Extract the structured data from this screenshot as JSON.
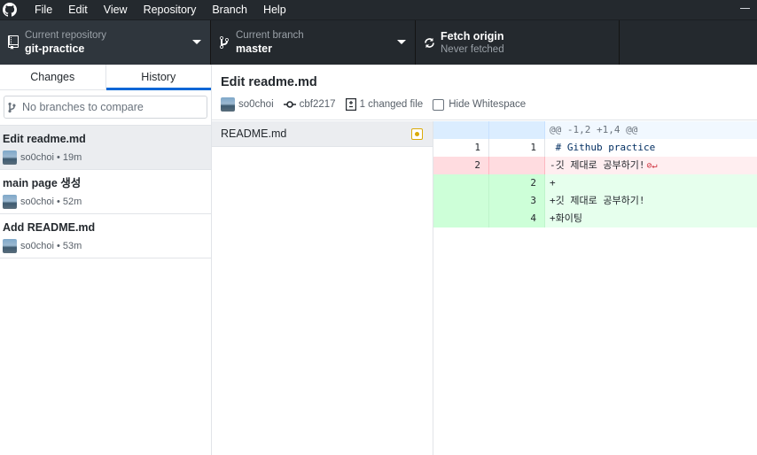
{
  "menu": [
    "File",
    "Edit",
    "View",
    "Repository",
    "Branch",
    "Help"
  ],
  "toolbar": {
    "repo": {
      "label": "Current repository",
      "value": "git-practice"
    },
    "branch": {
      "label": "Current branch",
      "value": "master"
    },
    "fetch": {
      "label": "Fetch origin",
      "sub": "Never fetched"
    }
  },
  "sidebar": {
    "tabs": {
      "changes": "Changes",
      "history": "History"
    },
    "compare_placeholder": "No branches to compare",
    "commits": [
      {
        "title": "Edit readme.md",
        "meta": "so0choi • 19m"
      },
      {
        "title": "main page 생성",
        "meta": "so0choi • 52m"
      },
      {
        "title": "Add README.md",
        "meta": "so0choi • 53m"
      }
    ]
  },
  "commit": {
    "title": "Edit readme.md",
    "author": "so0choi",
    "sha": "cbf2217",
    "changed": "1 changed file",
    "hide_ws": "Hide Whitespace"
  },
  "files": [
    {
      "name": "README.md",
      "status": "modified"
    }
  ],
  "diff": {
    "hunk": "@@ -1,2 +1,4 @@",
    "lines": [
      {
        "type": "ctx",
        "old": "1",
        "new": "1",
        "text": " # Github practice"
      },
      {
        "type": "del",
        "old": "2",
        "new": "",
        "text": "-깃 제대로 공부하기!"
      },
      {
        "type": "add",
        "old": "",
        "new": "2",
        "text": "+"
      },
      {
        "type": "add",
        "old": "",
        "new": "3",
        "text": "+깃 제대로 공부하기!"
      },
      {
        "type": "add",
        "old": "",
        "new": "4",
        "text": "+화이팅"
      }
    ]
  }
}
